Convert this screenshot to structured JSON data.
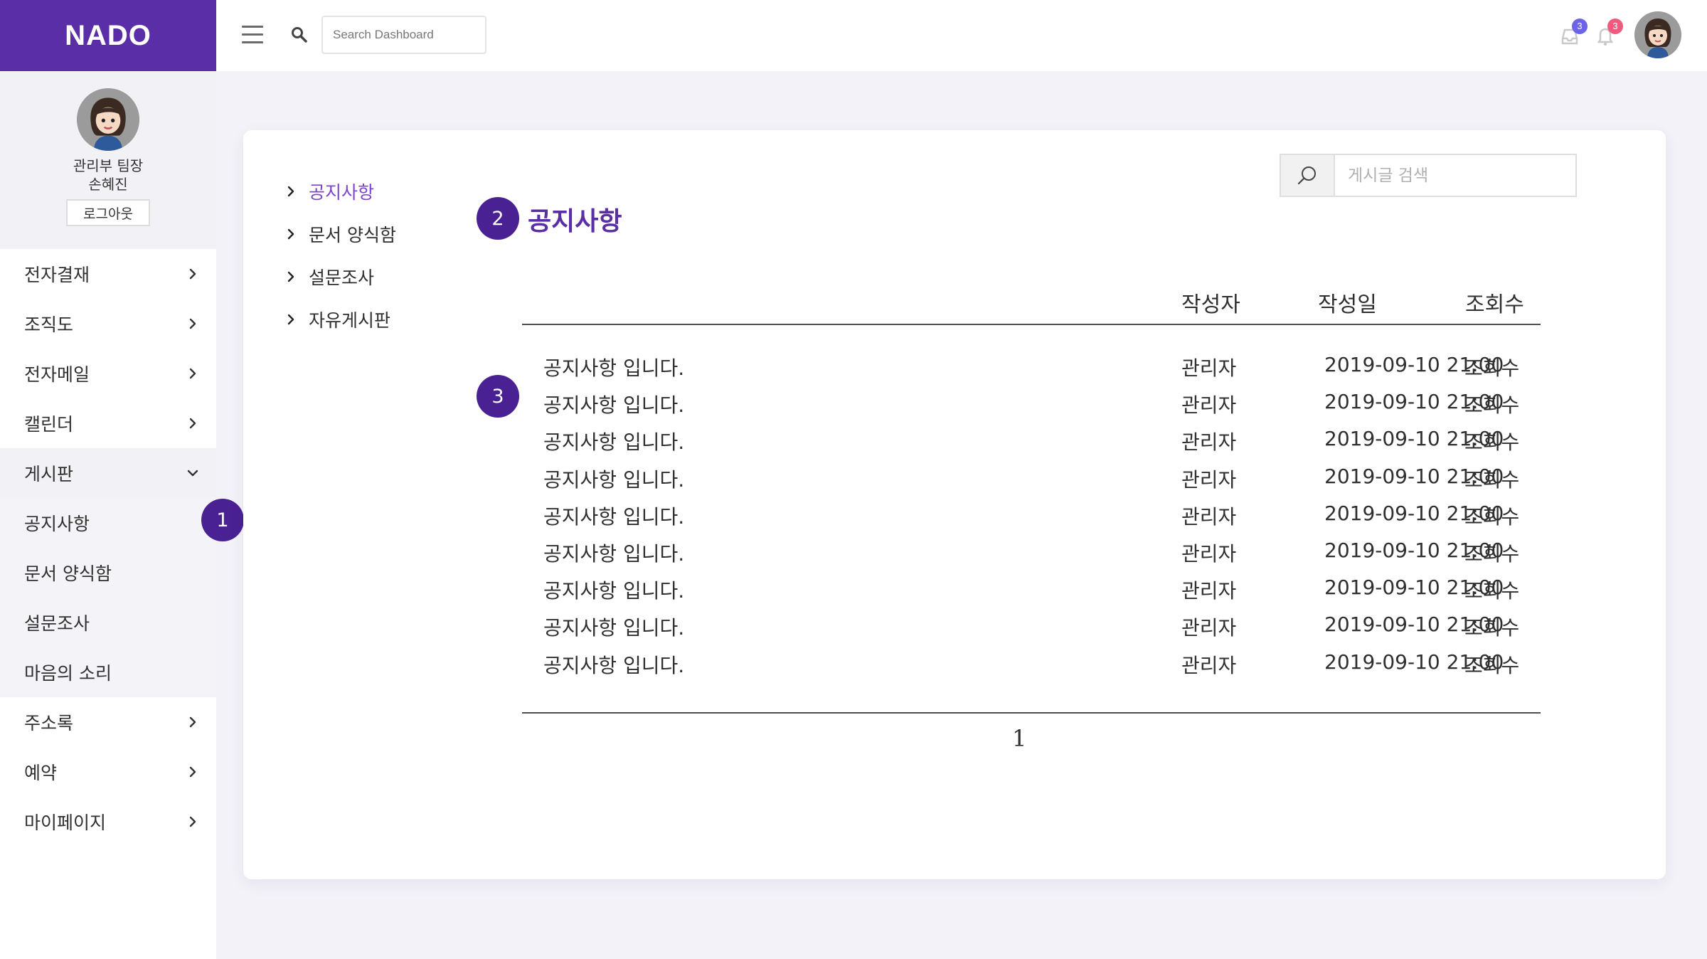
{
  "app": {
    "logo": "NADO"
  },
  "topbar": {
    "search_placeholder": "Search Dashboard",
    "messages_badge": "3",
    "notifications_badge": "3"
  },
  "profile": {
    "role": "관리부 팀장",
    "name": "손혜진",
    "logout_label": "로그아웃"
  },
  "sidebar": {
    "items_top": [
      {
        "label": "전자결재"
      },
      {
        "label": "조직도"
      },
      {
        "label": "전자메일"
      },
      {
        "label": "캘린더"
      }
    ],
    "board": {
      "label": "게시판",
      "children": [
        {
          "label": "공지사항"
        },
        {
          "label": "문서 양식함"
        },
        {
          "label": "설문조사"
        },
        {
          "label": "마음의 소리"
        }
      ]
    },
    "items_bottom": [
      {
        "label": "주소록"
      },
      {
        "label": "예약"
      },
      {
        "label": "마이페이지"
      }
    ]
  },
  "steps": {
    "one": "1",
    "two": "2",
    "three": "3"
  },
  "board_nav": [
    {
      "label": "공지사항"
    },
    {
      "label": "문서 양식함"
    },
    {
      "label": "설문조사"
    },
    {
      "label": "자유게시판"
    }
  ],
  "board": {
    "title": "공지사항",
    "search_placeholder": "게시글 검색",
    "columns": {
      "author": "작성자",
      "date": "작성일",
      "views": "조회수"
    },
    "rows": [
      {
        "title": "공지사항 입니다.",
        "author": "관리자",
        "date": "2019-09-10 21:00",
        "views": "조회수"
      },
      {
        "title": "공지사항 입니다.",
        "author": "관리자",
        "date": "2019-09-10 21:00",
        "views": "조회수"
      },
      {
        "title": "공지사항 입니다.",
        "author": "관리자",
        "date": "2019-09-10 21:00",
        "views": "조회수"
      },
      {
        "title": "공지사항 입니다.",
        "author": "관리자",
        "date": "2019-09-10 21:00",
        "views": "조회수"
      },
      {
        "title": "공지사항 입니다.",
        "author": "관리자",
        "date": "2019-09-10 21:00",
        "views": "조회수"
      },
      {
        "title": "공지사항 입니다.",
        "author": "관리자",
        "date": "2019-09-10 21:00",
        "views": "조회수"
      },
      {
        "title": "공지사항 입니다.",
        "author": "관리자",
        "date": "2019-09-10 21:00",
        "views": "조회수"
      },
      {
        "title": "공지사항 입니다.",
        "author": "관리자",
        "date": "2019-09-10 21:00",
        "views": "조회수"
      },
      {
        "title": "공지사항 입니다.",
        "author": "관리자",
        "date": "2019-09-10 21:00",
        "views": "조회수"
      }
    ],
    "pagination": [
      "1"
    ]
  }
}
